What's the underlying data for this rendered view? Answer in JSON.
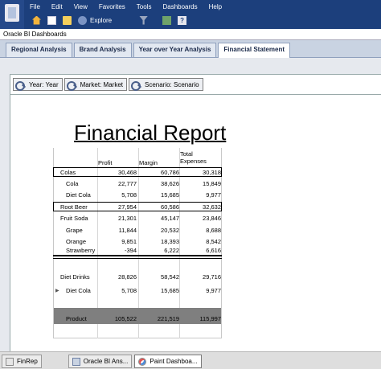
{
  "menu": [
    "File",
    "Edit",
    "View",
    "Favorites",
    "Tools",
    "Dashboards",
    "Help"
  ],
  "toolbar": {
    "explore_label": "Explore"
  },
  "app_name": "Oracle BI Dashboards",
  "dashboard_tabs": [
    "Regional Analysis",
    "Brand Analysis",
    "Year over Year Analysis",
    "Financial Statement"
  ],
  "prompts": [
    "Year: Year",
    "Market: Market",
    "Scenario: Scenario"
  ],
  "report": {
    "title": "Financial Report",
    "headers": {
      "profit": "Profit",
      "margin": "Margin",
      "total_expenses_1": "Total",
      "total_expenses_2": "Expenses"
    },
    "rows": [
      {
        "label": "Colas",
        "profit": "30,468",
        "margin": "60,786",
        "expenses": "30,318"
      },
      {
        "label": "Cola",
        "profit": "22,777",
        "margin": "38,626",
        "expenses": "15,849"
      },
      {
        "label": "Diet Cola",
        "profit": "5,708",
        "margin": "15,685",
        "expenses": "9,977"
      },
      {
        "label": "Root Beer",
        "profit": "27,954",
        "margin": "60,586",
        "expenses": "32,632"
      },
      {
        "label": "Fruit Soda",
        "profit": "21,301",
        "margin": "45,147",
        "expenses": "23,846"
      },
      {
        "label": "Grape",
        "profit": "11,844",
        "margin": "20,532",
        "expenses": "8,688"
      },
      {
        "label": "Orange",
        "profit": "9,851",
        "margin": "18,393",
        "expenses": "8,542"
      },
      {
        "label": "Strawberry",
        "profit": "-394",
        "margin": "6,222",
        "expenses": "6,616"
      },
      {
        "label": "Diet Drinks",
        "profit": "28,826",
        "margin": "58,542",
        "expenses": "29,716"
      },
      {
        "label": "Diet Cola",
        "profit": "5,708",
        "margin": "15,685",
        "expenses": "9,977"
      },
      {
        "label": "Product",
        "profit": "105,522",
        "margin": "221,519",
        "expenses": "115,997"
      }
    ]
  },
  "taskbar": [
    "FinRep",
    "Oracle BI Ans...",
    "Paint Dashboa..."
  ],
  "colors": {
    "title_bar": "#1c3f7c",
    "tab_bar": "#c9d3e2",
    "total_band": "#7f7f7f"
  }
}
